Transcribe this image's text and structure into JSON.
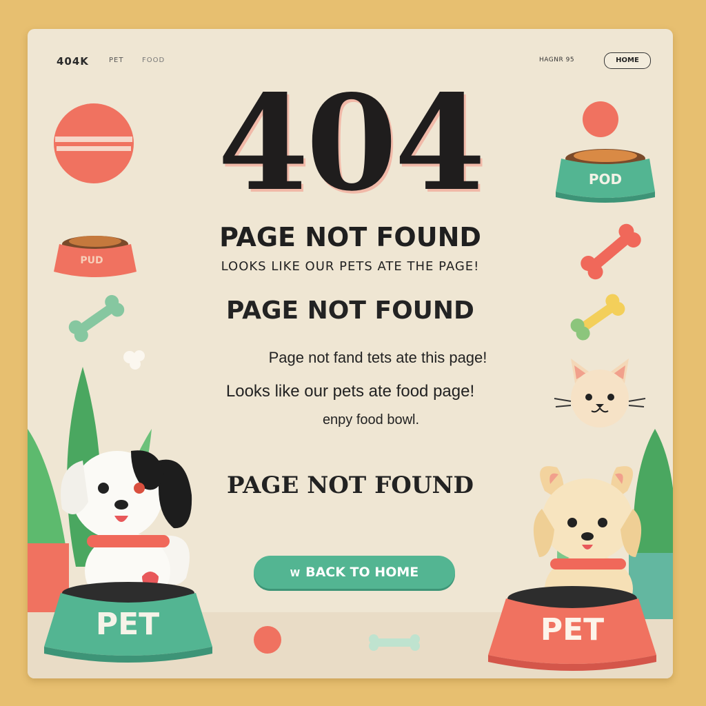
{
  "header": {
    "brand": "404K",
    "nav_items": [
      "PET",
      "FOOD"
    ],
    "right_text": "HAGNR 95",
    "home_button": "HOME"
  },
  "hero": {
    "code": "404",
    "title": "PAGE NOT FOUND",
    "subtitle": "LOOKS LIKE OUR PETS ATE THE PAGE!",
    "title_repeat": "PAGE NOT FOUND"
  },
  "messages": [
    "Page not fand tets ate this page!",
    "Looks like our pets ate food page!",
    "enpy food bowl."
  ],
  "footer_title": "PAGE NOT FOUND",
  "cta": {
    "label": "BACK TO HOME",
    "arrow": "W"
  },
  "bowls": {
    "top_right": "POD",
    "left_small": "PUD",
    "bottom_left": "PET",
    "bottom_right": "PET"
  },
  "colors": {
    "background": "#e7bf70",
    "card": "#efe6d3",
    "accent_green": "#53b592",
    "accent_coral": "#f07260",
    "text_dark": "#1f1d1d"
  }
}
